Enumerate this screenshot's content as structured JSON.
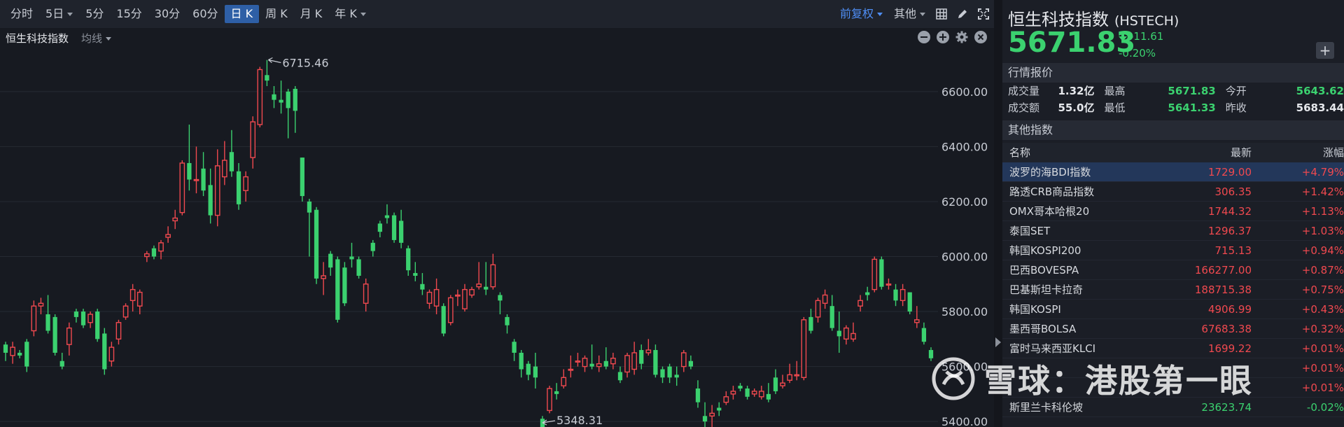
{
  "toolbar": {
    "periods": [
      {
        "label": "分时",
        "caret": false,
        "active": false
      },
      {
        "label": "5日",
        "caret": true,
        "active": false
      },
      {
        "label": "5分",
        "caret": false,
        "active": false
      },
      {
        "label": "15分",
        "caret": false,
        "active": false
      },
      {
        "label": "30分",
        "caret": false,
        "active": false
      },
      {
        "label": "60分",
        "caret": false,
        "active": false
      },
      {
        "label": "日 K",
        "caret": false,
        "active": true
      },
      {
        "label": "周 K",
        "caret": false,
        "active": false
      },
      {
        "label": "月 K",
        "caret": false,
        "active": false
      },
      {
        "label": "年 K",
        "caret": true,
        "active": false
      }
    ],
    "adjust_label": "前复权",
    "other_label": "其他"
  },
  "subbar": {
    "name": "恒生科技指数",
    "ma_label": "均线"
  },
  "chart_data": {
    "type": "candlestick",
    "ylim": [
      5380,
      6760
    ],
    "y_ticks": [
      "6600.00",
      "6400.00",
      "6200.00",
      "6000.00",
      "5800.00",
      "5600.00",
      "5400.00"
    ],
    "y_tick_values": [
      6600,
      6400,
      6200,
      6000,
      5800,
      5600,
      5400
    ],
    "annotations": [
      {
        "label": "6715.46",
        "value": 6715.46,
        "kind": "high"
      },
      {
        "label": "5348.31",
        "value": 5348.31,
        "kind": "low"
      }
    ],
    "candles": [
      [
        5680,
        5650,
        5690,
        5620
      ],
      [
        5640,
        5670,
        5690,
        5610
      ],
      [
        5650,
        5640,
        5660,
        5630
      ],
      [
        5690,
        5600,
        5700,
        5580
      ],
      [
        5730,
        5820,
        5840,
        5710
      ],
      [
        5820,
        5830,
        5850,
        5790
      ],
      [
        5790,
        5730,
        5860,
        5720
      ],
      [
        5780,
        5650,
        5790,
        5640
      ],
      [
        5620,
        5600,
        5650,
        5590
      ],
      [
        5680,
        5740,
        5760,
        5640
      ],
      [
        5800,
        5780,
        5810,
        5760
      ],
      [
        5800,
        5750,
        5810,
        5740
      ],
      [
        5760,
        5790,
        5800,
        5740
      ],
      [
        5800,
        5700,
        5810,
        5690
      ],
      [
        5720,
        5590,
        5740,
        5570
      ],
      [
        5620,
        5670,
        5690,
        5600
      ],
      [
        5700,
        5760,
        5770,
        5680
      ],
      [
        5780,
        5820,
        5830,
        5770
      ],
      [
        5840,
        5880,
        5900,
        5800
      ],
      [
        5820,
        5870,
        5880,
        5790
      ],
      [
        6000,
        6010,
        6020,
        5980
      ],
      [
        6030,
        6000,
        6040,
        5990
      ],
      [
        6020,
        6050,
        6060,
        5990
      ],
      [
        6070,
        6080,
        6110,
        6050
      ],
      [
        6130,
        6140,
        6170,
        6100
      ],
      [
        6160,
        6340,
        6350,
        6150
      ],
      [
        6340,
        6280,
        6480,
        6240
      ],
      [
        6280,
        6280,
        6400,
        6230
      ],
      [
        6320,
        6240,
        6380,
        6220
      ],
      [
        6260,
        6150,
        6320,
        6120
      ],
      [
        6150,
        6330,
        6390,
        6110
      ],
      [
        6290,
        6350,
        6420,
        6260
      ],
      [
        6380,
        6310,
        6460,
        6290
      ],
      [
        6310,
        6190,
        6340,
        6170
      ],
      [
        6240,
        6290,
        6310,
        6200
      ],
      [
        6360,
        6490,
        6510,
        6320
      ],
      [
        6480,
        6680,
        6690,
        6470
      ],
      [
        6660,
        6640,
        6715,
        6620
      ],
      [
        6590,
        6570,
        6620,
        6540
      ],
      [
        6570,
        6560,
        6640,
        6520
      ],
      [
        6600,
        6540,
        6610,
        6430
      ],
      [
        6610,
        6530,
        6620,
        6450
      ],
      [
        6360,
        6220,
        6360,
        6200
      ],
      [
        6200,
        6160,
        6210,
        6000
      ],
      [
        6170,
        5920,
        6180,
        5900
      ],
      [
        5920,
        5930,
        5980,
        5860
      ],
      [
        6010,
        5960,
        6020,
        5930
      ],
      [
        5990,
        5770,
        6000,
        5760
      ],
      [
        5960,
        5830,
        5980,
        5820
      ],
      [
        6000,
        5990,
        6050,
        5960
      ],
      [
        5990,
        5930,
        6000,
        5920
      ],
      [
        5830,
        5900,
        5920,
        5800
      ],
      [
        6050,
        6020,
        6060,
        6000
      ],
      [
        6120,
        6090,
        6130,
        6070
      ],
      [
        6150,
        6140,
        6190,
        6120
      ],
      [
        6150,
        6060,
        6160,
        6050
      ],
      [
        6130,
        6050,
        6170,
        6030
      ],
      [
        6030,
        5950,
        6040,
        5930
      ],
      [
        5940,
        5930,
        5980,
        5910
      ],
      [
        5900,
        5880,
        5940,
        5860
      ],
      [
        5830,
        5870,
        5880,
        5810
      ],
      [
        5820,
        5880,
        5920,
        5790
      ],
      [
        5820,
        5720,
        5830,
        5710
      ],
      [
        5760,
        5850,
        5860,
        5750
      ],
      [
        5860,
        5860,
        5880,
        5820
      ],
      [
        5810,
        5880,
        5900,
        5800
      ],
      [
        5860,
        5880,
        5890,
        5850
      ],
      [
        5890,
        5900,
        5980,
        5880
      ],
      [
        5890,
        5880,
        5980,
        5860
      ],
      [
        5890,
        5970,
        6010,
        5880
      ],
      [
        5860,
        5840,
        5870,
        5790
      ],
      [
        5780,
        5750,
        5790,
        5720
      ],
      [
        5690,
        5650,
        5700,
        5620
      ],
      [
        5650,
        5590,
        5660,
        5560
      ],
      [
        5610,
        5570,
        5620,
        5550
      ],
      [
        5600,
        5560,
        5650,
        5520
      ],
      [
        5410,
        5350,
        5420,
        5340
      ],
      [
        5440,
        5520,
        5530,
        5430
      ],
      [
        5510,
        5500,
        5540,
        5480
      ],
      [
        5530,
        5560,
        5590,
        5520
      ],
      [
        5590,
        5590,
        5640,
        5560
      ],
      [
        5620,
        5620,
        5650,
        5600
      ],
      [
        5600,
        5630,
        5640,
        5580
      ],
      [
        5610,
        5600,
        5680,
        5590
      ],
      [
        5600,
        5610,
        5640,
        5580
      ],
      [
        5620,
        5600,
        5670,
        5590
      ],
      [
        5610,
        5630,
        5650,
        5590
      ],
      [
        5580,
        5550,
        5600,
        5540
      ],
      [
        5580,
        5640,
        5650,
        5560
      ],
      [
        5590,
        5650,
        5690,
        5570
      ],
      [
        5660,
        5610,
        5680,
        5590
      ],
      [
        5650,
        5660,
        5700,
        5640
      ],
      [
        5660,
        5570,
        5680,
        5560
      ],
      [
        5590,
        5560,
        5600,
        5540
      ],
      [
        5600,
        5560,
        5610,
        5540
      ],
      [
        5570,
        5560,
        5600,
        5530
      ],
      [
        5600,
        5650,
        5660,
        5580
      ],
      [
        5620,
        5600,
        5640,
        5590
      ],
      [
        5520,
        5470,
        5550,
        5450
      ],
      [
        5420,
        5400,
        5470,
        5380
      ],
      [
        5420,
        5430,
        5460,
        5348
      ],
      [
        5450,
        5440,
        5470,
        5420
      ],
      [
        5470,
        5490,
        5510,
        5460
      ],
      [
        5500,
        5510,
        5530,
        5480
      ],
      [
        5530,
        5520,
        5540,
        5510
      ],
      [
        5520,
        5490,
        5530,
        5480
      ],
      [
        5500,
        5510,
        5520,
        5490
      ],
      [
        5490,
        5510,
        5530,
        5480
      ],
      [
        5500,
        5480,
        5540,
        5470
      ],
      [
        5560,
        5510,
        5590,
        5500
      ],
      [
        5530,
        5540,
        5570,
        5520
      ],
      [
        5550,
        5570,
        5610,
        5540
      ],
      [
        5570,
        5570,
        5620,
        5550
      ],
      [
        5560,
        5770,
        5780,
        5550
      ],
      [
        5780,
        5730,
        5810,
        5720
      ],
      [
        5780,
        5840,
        5850,
        5760
      ],
      [
        5830,
        5860,
        5880,
        5810
      ],
      [
        5820,
        5740,
        5860,
        5730
      ],
      [
        5730,
        5710,
        5800,
        5650
      ],
      [
        5700,
        5740,
        5750,
        5680
      ],
      [
        5700,
        5720,
        5760,
        5690
      ],
      [
        5820,
        5840,
        5860,
        5800
      ],
      [
        5870,
        5860,
        5890,
        5840
      ],
      [
        5880,
        5990,
        6000,
        5870
      ],
      [
        5990,
        5890,
        6000,
        5880
      ],
      [
        5900,
        5900,
        5920,
        5880
      ],
      [
        5880,
        5840,
        5900,
        5820
      ],
      [
        5840,
        5880,
        5900,
        5820
      ],
      [
        5870,
        5800,
        5870,
        5790
      ],
      [
        5760,
        5770,
        5820,
        5740
      ],
      [
        5740,
        5690,
        5760,
        5680
      ],
      [
        5660,
        5630,
        5670,
        5620
      ]
    ]
  },
  "right": {
    "title": "恒生科技指数",
    "code": "(HSTECH)",
    "price": "5671.83",
    "change": "-11.61",
    "change_pct": "-0.20%",
    "add_label": "+",
    "quote_header": "行情报价",
    "quote": {
      "vol_label": "成交量",
      "vol": "1.32亿",
      "high_label": "最高",
      "high": "5671.83",
      "open_label": "今开",
      "open": "5643.62",
      "amt_label": "成交额",
      "amt": "55.0亿",
      "low_label": "最低",
      "low": "5641.33",
      "prev_label": "昨收",
      "prev": "5683.44"
    },
    "others_header": "其他指数",
    "table_head": {
      "name": "名称",
      "latest": "最新",
      "chg": "涨幅"
    },
    "rows": [
      {
        "name": "波罗的海BDI指数",
        "latest": "1729.00",
        "chg": "+4.79%",
        "selected": true
      },
      {
        "name": "路透CRB商品指数",
        "latest": "306.35",
        "chg": "+1.42%"
      },
      {
        "name": "OMX哥本哈根20",
        "latest": "1744.32",
        "chg": "+1.13%"
      },
      {
        "name": "泰国SET",
        "latest": "1296.37",
        "chg": "+1.03%"
      },
      {
        "name": "韩国KOSPI200",
        "latest": "715.13",
        "chg": "+0.94%"
      },
      {
        "name": "巴西BOVESPA",
        "latest": "166277.00",
        "chg": "+0.87%"
      },
      {
        "name": "巴基斯坦卡拉奇",
        "latest": "188715.38",
        "chg": "+0.75%"
      },
      {
        "name": "韩国KOSPI",
        "latest": "4906.99",
        "chg": "+0.43%"
      },
      {
        "name": "墨西哥BOLSA",
        "latest": "67683.38",
        "chg": "+0.32%"
      },
      {
        "name": "富时马来西亚KLCI",
        "latest": "1699.22",
        "chg": "+0.01%"
      },
      {
        "name": "",
        "latest": "",
        "chg": "+0.01%"
      },
      {
        "name": "",
        "latest": "",
        "chg": "+0.01%"
      },
      {
        "name": "斯里兰卡科伦坡",
        "latest": "23623.74",
        "chg": "-0.02%",
        "down": true
      }
    ]
  },
  "watermark": {
    "text": "雪球：港股第一眼"
  },
  "colors": {
    "up": "#f0494f",
    "down": "#3bd16f",
    "accent": "#4f8ff7"
  },
  "icons": [
    "chevron-down-icon",
    "grid-icon",
    "pen-icon",
    "fullscreen-icon",
    "minus-circle-icon",
    "plus-circle-icon",
    "gear-icon",
    "close-circle-icon",
    "arrow-down-icon",
    "chevron-right-icon"
  ]
}
